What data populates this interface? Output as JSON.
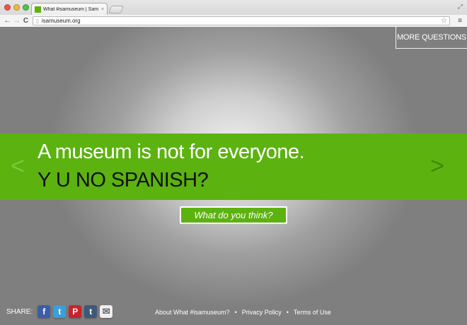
{
  "browser": {
    "tab_title": "What #isamuseum | Sam D",
    "tab_close": "×",
    "url": "isamuseum.org",
    "icons": [
      "back-icon",
      "forward-icon",
      "reload-icon",
      "page-icon",
      "star-icon",
      "menu-icon",
      "fullscreen-icon"
    ]
  },
  "header": {
    "more_questions": "MORE QUESTIONS"
  },
  "banner": {
    "headline": "A museum is not for everyone.",
    "subline": "Y U NO SPANISH?",
    "accent_color": "#5cb20f"
  },
  "cta": {
    "label": "What do you think?"
  },
  "share": {
    "label": "SHARE:",
    "buttons": [
      {
        "name": "facebook",
        "glyph": "f"
      },
      {
        "name": "twitter",
        "glyph": "t"
      },
      {
        "name": "pinterest",
        "glyph": "P"
      },
      {
        "name": "tumblr",
        "glyph": "t"
      },
      {
        "name": "email",
        "glyph": "✉"
      }
    ]
  },
  "footer": {
    "links": [
      "About What #isamuseum?",
      "Privacy Policy",
      "Terms of Use"
    ],
    "separator": "•"
  }
}
